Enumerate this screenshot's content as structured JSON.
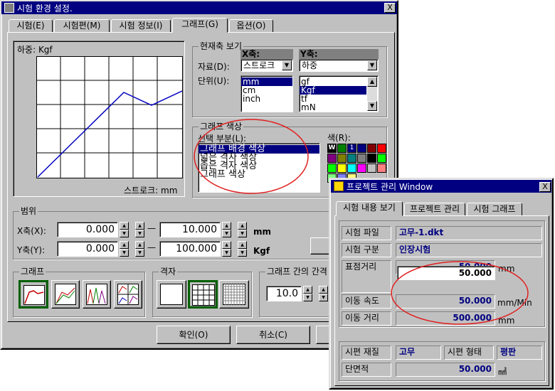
{
  "main_window": {
    "title": "시험 환경 설정.",
    "close": "X",
    "tabs": [
      {
        "label": "시험(E)"
      },
      {
        "label": "시험편(M)"
      },
      {
        "label": "시험 정보(I)"
      },
      {
        "label": "그래프(G)"
      },
      {
        "label": "옵션(O)"
      }
    ],
    "graph_preview": {
      "load_label": "하중: Kgf",
      "stroke_label": "스트로크: mm"
    },
    "axis_view": {
      "title": "현재축 보기",
      "x_header": "X축:",
      "y_header": "Y축:",
      "data_label": "자료(D):",
      "unit_label": "단위(U):",
      "x_data_value": "스트로크",
      "y_data_value": "하중",
      "x_units": [
        "mm",
        "cm",
        "inch"
      ],
      "x_unit_selected": "mm",
      "y_units": [
        "gf",
        "Kgf",
        "tf",
        "mN"
      ],
      "y_unit_selected": "Kgf"
    },
    "graph_color": {
      "title": "그래프 색상",
      "select_label": "선택 부분(L):",
      "color_label": "색(R):",
      "items": [
        "그래프 배경 색상",
        "넓은 격자 색상",
        "좁은 격자 색상",
        "그래프 색상"
      ],
      "selected": "그래프 배경 색상",
      "palette": [
        "#ffffff",
        "#008000",
        "#000080",
        "#000080",
        "#800000",
        "#ff0000",
        "#800080",
        "#808000",
        "#008080",
        "#808080",
        "#000000",
        "#00ff00",
        "#00ff00",
        "#ffff00",
        "#00ffff",
        "#ff00ff",
        "#c0c0c0",
        "#ff8080",
        "#80ff80",
        "#8080ff",
        "#ffff80"
      ],
      "palette_marks": {
        "first": "W",
        "fourth": "1"
      }
    },
    "range": {
      "title": "범위",
      "x_label": "X축(X):",
      "y_label": "Y축(Y):",
      "x_min": "0.000",
      "x_max": "10.000",
      "x_unit": "mm",
      "y_min": "0.000",
      "y_max": "100.000",
      "y_unit": "Kgf"
    },
    "graph_group": {
      "title": "그래프"
    },
    "grid_group": {
      "title": "격자"
    },
    "interval_group": {
      "title": "그래프 간의 간격",
      "value": "10.0"
    },
    "buttons": {
      "ok": "확인(O)",
      "cancel": "취소(C)"
    }
  },
  "project_window": {
    "title": "프로젝트 관리 Window",
    "close": "X",
    "tabs": [
      {
        "label": "시험 내용 보기"
      },
      {
        "label": "프로젝트 관리"
      },
      {
        "label": "시험 그래프"
      }
    ],
    "rows": {
      "test_file_label": "시험 파일",
      "test_file_value": "고무-1.dkt",
      "test_type_label": "시험 구분",
      "test_type_value": "인장시험",
      "gauge_label": "표점거리",
      "gauge_value_back": "50.000",
      "gauge_value": "50.000",
      "gauge_unit": "mm",
      "speed_label": "이동 속도",
      "speed_value": "50.000",
      "speed_unit": "mm/Min",
      "distance_label": "이동 거리",
      "distance_value": "500.000",
      "distance_unit": "mm",
      "material_label": "시편 재질",
      "material_value": "고무",
      "shape_label": "시편 형태",
      "shape_value": "평판",
      "area_label": "단면적",
      "area_value": "50.000",
      "area_unit": "㎟"
    }
  },
  "colors": {
    "annotation": "#e02020",
    "title_bar": "#000080",
    "graph_line": "#0000c0"
  }
}
